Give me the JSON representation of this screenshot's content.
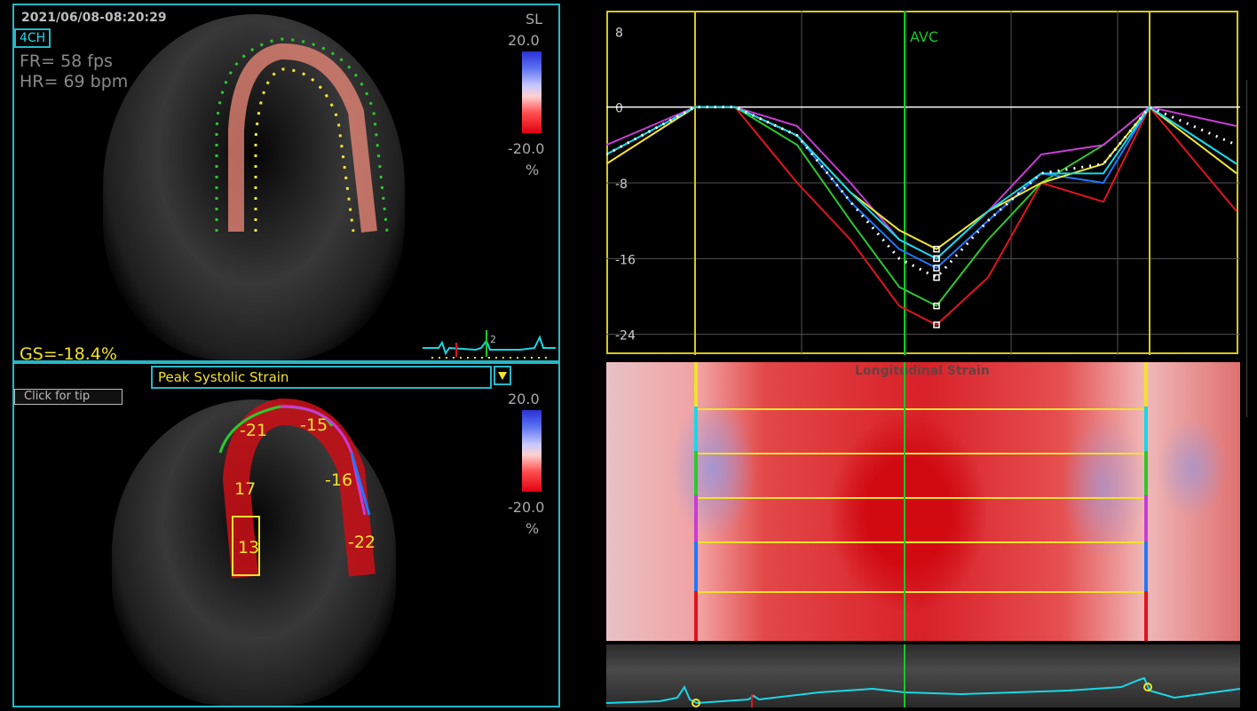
{
  "top_panel": {
    "timestamp": "2021/06/08-08:20:29",
    "view_label": "4CH",
    "fr": "FR= 58 fps",
    "hr": "HR= 69 bpm",
    "mode": "SL",
    "scale_max": "20.0",
    "scale_min": "-20.0",
    "unit": "%",
    "gs": "GS=-18.4%",
    "ecg_beat_label": "2"
  },
  "bottom_panel": {
    "dropdown_value": "Peak Systolic Strain",
    "tip_text": "Click for tip",
    "scale_max": "20.0",
    "scale_min": "-20.0",
    "unit": "%",
    "segments": [
      "-21",
      "-15",
      "17",
      "-16",
      "13",
      "-22"
    ]
  },
  "chart_data": {
    "type": "line",
    "ylim": [
      -26,
      10
    ],
    "yticks": [
      "8",
      "0",
      "-8",
      "-16",
      "-24"
    ],
    "event_marker": "AVC",
    "series": [
      {
        "color": "#e1141e",
        "values": [
          -6,
          0,
          0,
          -8,
          -14,
          -21,
          -23,
          -18,
          -8,
          -10,
          0,
          -11
        ]
      },
      {
        "color": "#2ec82e",
        "values": [
          -5,
          0,
          0,
          -4,
          -12,
          -19,
          -21,
          -14,
          -8,
          -4,
          0,
          -6
        ]
      },
      {
        "color": "#1e78ff",
        "values": [
          -5,
          0,
          0,
          -3,
          -10,
          -15,
          -17,
          -12,
          -7,
          -8,
          0,
          -6
        ]
      },
      {
        "color": "#c83cd6",
        "values": [
          -4,
          0,
          0,
          -2,
          -8,
          -14,
          -16,
          -11,
          -5,
          -4,
          0,
          -2
        ]
      },
      {
        "color": "#f0e632",
        "values": [
          -6,
          0,
          0,
          -3,
          -9,
          -13,
          -15,
          -11,
          -8,
          -6,
          0,
          -7
        ]
      },
      {
        "color": "#18d8e8",
        "values": [
          -5,
          0,
          0,
          -3,
          -9,
          -14,
          -16,
          -11,
          -7,
          -7,
          0,
          -6
        ]
      },
      {
        "color": "#ffffff",
        "values": [
          -5,
          0,
          0,
          -3,
          -10,
          -16,
          -18,
          -12,
          -7,
          -6,
          0,
          -4
        ]
      }
    ]
  },
  "strain_map": {
    "title": "Longitudinal Strain"
  },
  "colors": {
    "panel_border": "#27b7c7",
    "label_yellow": "#f2e22c",
    "avc_green": "#18c828"
  }
}
